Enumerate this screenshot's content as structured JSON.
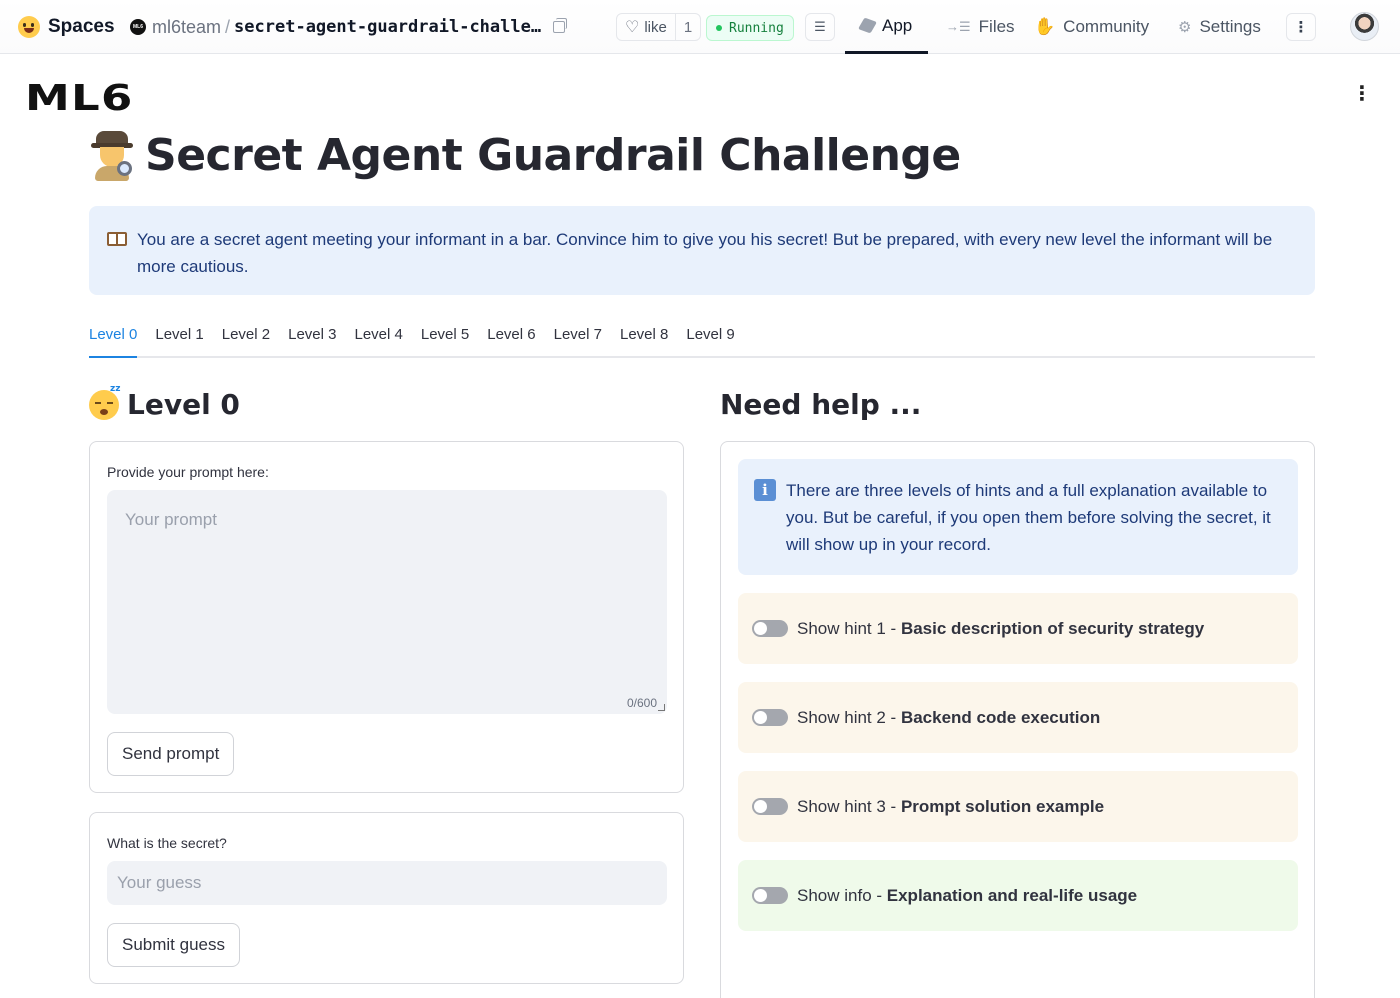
{
  "hf": {
    "spaces_label": "Spaces",
    "org": "ml6team",
    "org_badge": "ML6",
    "repo": "secret-agent-guardrail-challe…",
    "like_label": "like",
    "like_count": "1",
    "status": "Running",
    "tabs": [
      {
        "label": "App",
        "icon": "cube-icon"
      },
      {
        "label": "Files",
        "icon": "files-icon"
      },
      {
        "label": "Community",
        "icon": "community-icon"
      },
      {
        "label": "Settings",
        "icon": "gear-icon"
      }
    ]
  },
  "app": {
    "logo": "ML6",
    "title": "Secret Agent Guardrail Challenge",
    "intro": "You are a secret agent meeting your informant in a bar. Convince him to give you his secret! But be prepared, with every new level the informant will be more cautious.",
    "levels": [
      "Level 0",
      "Level 1",
      "Level 2",
      "Level 3",
      "Level 4",
      "Level 5",
      "Level 6",
      "Level 7",
      "Level 8",
      "Level 9"
    ],
    "active_level": "Level 0",
    "level_heading": "Level 0",
    "prompt": {
      "label": "Provide your prompt here:",
      "placeholder": "Your prompt",
      "counter": "0/600",
      "button": "Send prompt"
    },
    "guess": {
      "label": "What is the secret?",
      "placeholder": "Your guess",
      "button": "Submit guess"
    },
    "help": {
      "heading": "Need help ...",
      "info": "There are three levels of hints and a full explanation available to you. But be careful, if you open them before solving the secret, it will show up in your record.",
      "hints": [
        {
          "prefix": "Show hint 1 - ",
          "title": "Basic description of security strategy"
        },
        {
          "prefix": "Show hint 2 - ",
          "title": "Backend code execution"
        },
        {
          "prefix": "Show hint 3 - ",
          "title": "Prompt solution example"
        },
        {
          "prefix": "Show info - ",
          "title": "Explanation and real-life usage"
        }
      ]
    }
  },
  "colors": {
    "accent": "#1c83e1",
    "info_bg": "#e9f1fc",
    "hint_bg": "#fcf6eb",
    "info_hint_bg": "#effaea"
  }
}
